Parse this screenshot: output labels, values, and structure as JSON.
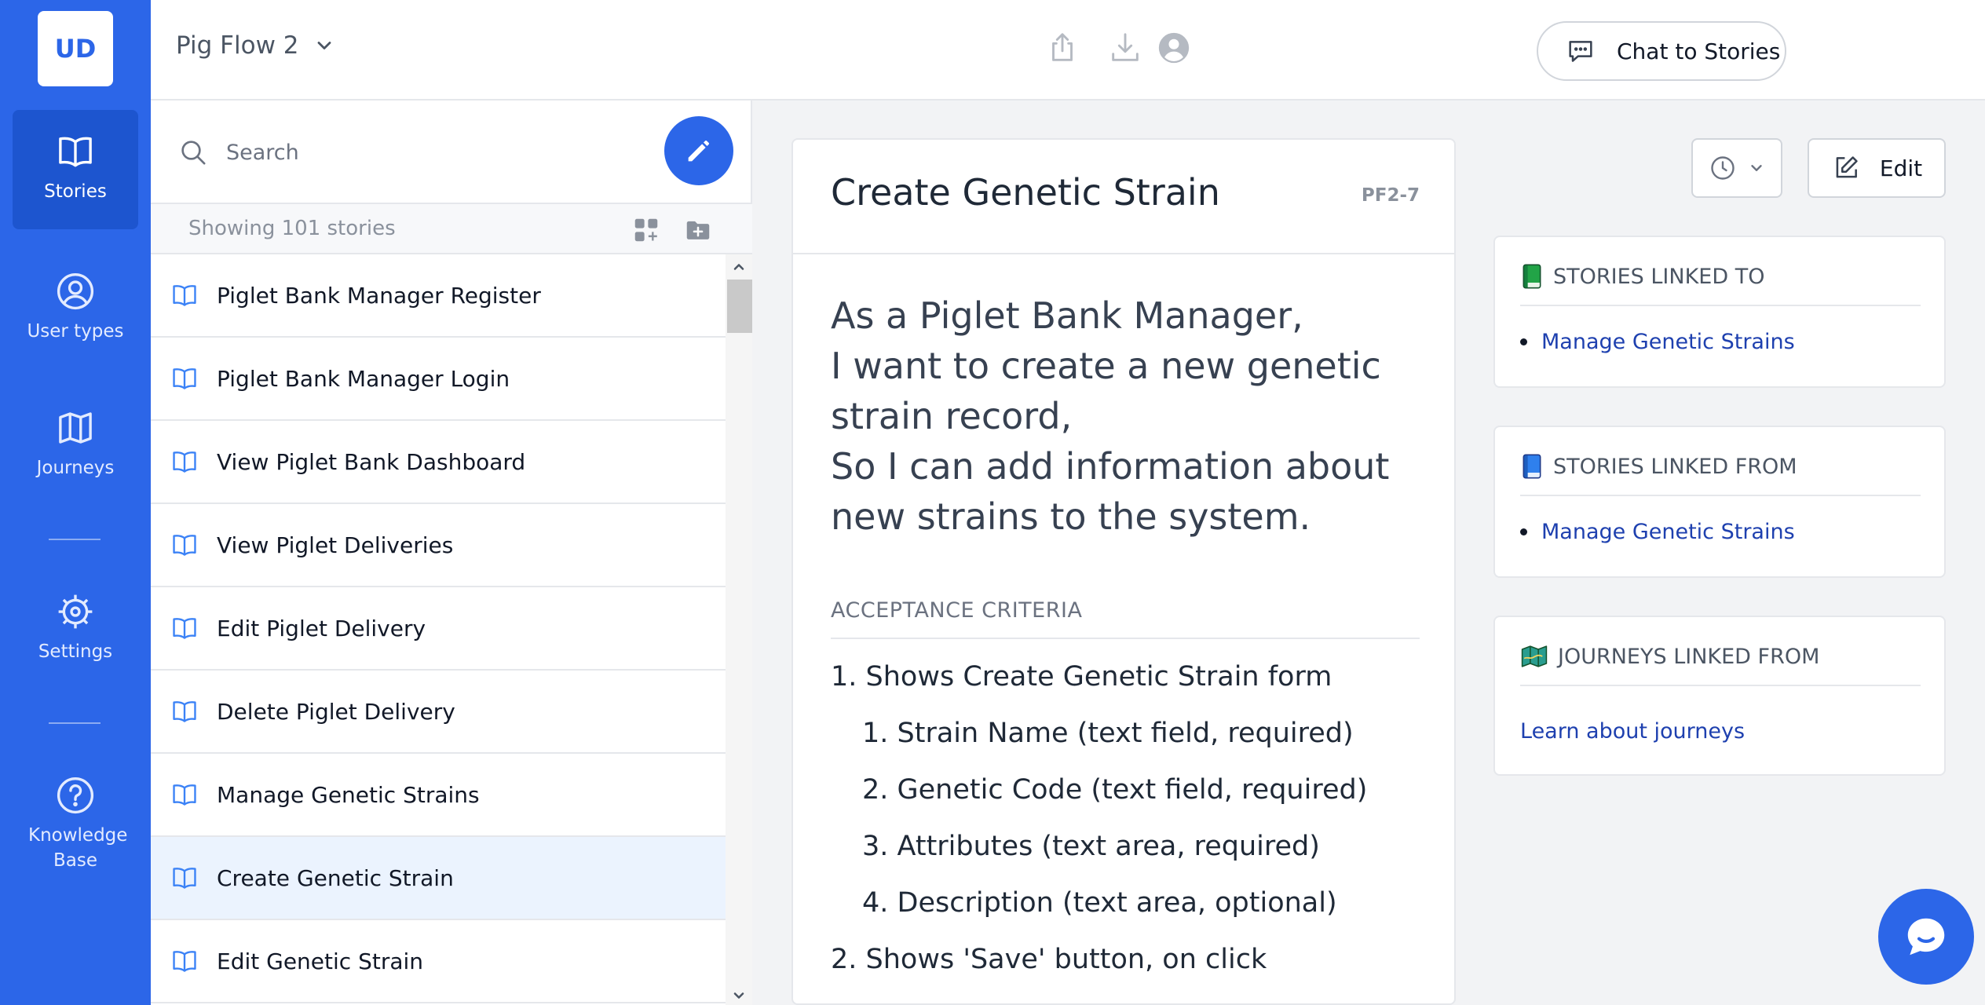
{
  "logo": "UD",
  "nav": {
    "stories": "Stories",
    "user_types": "User types",
    "journeys": "Journeys",
    "settings": "Settings",
    "knowledge_base": "Knowledge Base"
  },
  "topbar": {
    "project": "Pig Flow 2",
    "chat_button": "Chat to Stories"
  },
  "list": {
    "search_placeholder": "Search",
    "count_label": "Showing 101 stories",
    "stories": [
      "Piglet Bank Manager Register",
      "Piglet Bank Manager Login",
      "View Piglet Bank Dashboard",
      "View Piglet Deliveries",
      "Edit Piglet Delivery",
      "Delete Piglet Delivery",
      "Manage Genetic Strains",
      "Create Genetic Strain",
      "Edit Genetic Strain"
    ],
    "selected_index": 7
  },
  "story": {
    "title": "Create Genetic Strain",
    "id": "PF2-7",
    "lines": [
      "As a Piglet Bank Manager,",
      "I want to create a new genetic",
      "strain record,",
      "So I can add information about",
      "new strains to the system."
    ],
    "acceptance_label": "ACCEPTANCE CRITERIA",
    "criteria": [
      "1. Shows Create Genetic Strain form",
      "1. Strain Name (text field, required)",
      "2. Genetic Code (text field, required)",
      "3. Attributes (text area, required)",
      "4. Description (text area, optional)",
      "2. Shows 'Save' button, on click"
    ]
  },
  "actions": {
    "edit": "Edit"
  },
  "links": {
    "linked_to_title": "STORIES LINKED TO",
    "linked_to_item": "Manage Genetic Strains",
    "linked_from_title": "STORIES LINKED FROM",
    "linked_from_item": "Manage Genetic Strains",
    "journeys_title": "JOURNEYS LINKED FROM",
    "journeys_item": "Learn about journeys"
  },
  "colors": {
    "brand": "#2c66e8",
    "link": "#1e40af",
    "selected_row": "#ebf3fe"
  }
}
